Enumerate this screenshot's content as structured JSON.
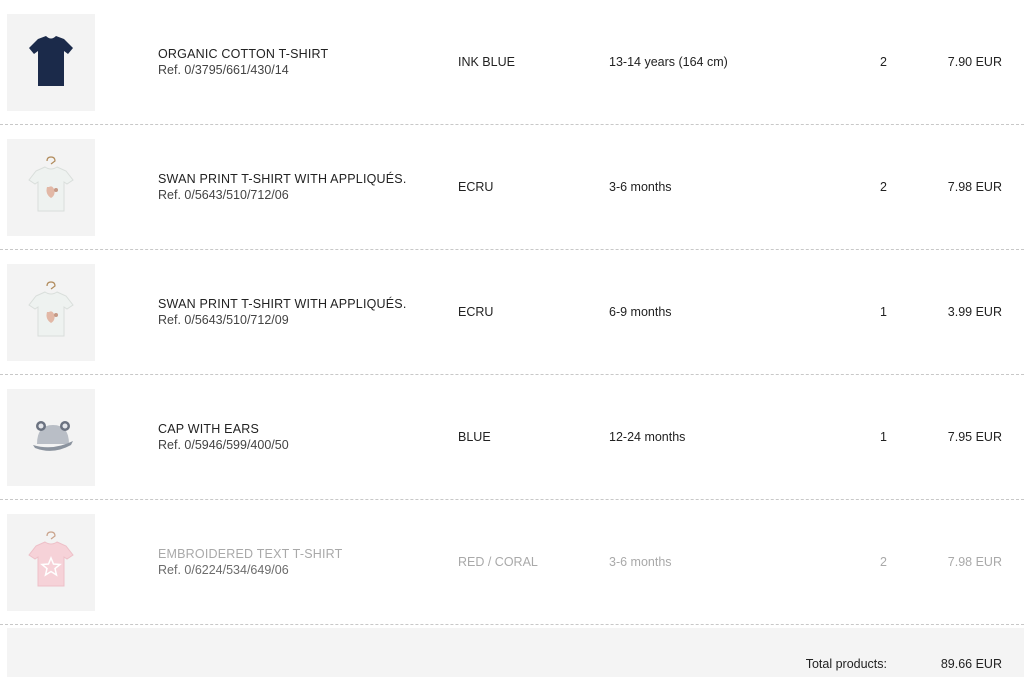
{
  "items": [
    {
      "name": "ORGANIC COTTON T-SHIRT",
      "ref": "Ref. 0/3795/661/430/14",
      "color": "INK BLUE",
      "size": "13-14 years (164 cm)",
      "qty": "2",
      "price": "7.90 EUR",
      "image": "navy-tshirt-icon",
      "faded": false
    },
    {
      "name": "SWAN PRINT T-SHIRT WITH APPLIQUÉS.",
      "ref": "Ref. 0/5643/510/712/06",
      "color": "ECRU",
      "size": "3-6 months",
      "qty": "2",
      "price": "7.98 EUR",
      "image": "swan-tshirt-icon",
      "faded": false
    },
    {
      "name": "SWAN PRINT T-SHIRT WITH APPLIQUÉS.",
      "ref": "Ref. 0/5643/510/712/09",
      "color": "ECRU",
      "size": "6-9 months",
      "qty": "1",
      "price": "3.99 EUR",
      "image": "swan-tshirt-icon",
      "faded": false
    },
    {
      "name": "CAP WITH EARS",
      "ref": "Ref. 0/5946/599/400/50",
      "color": "BLUE",
      "size": "12-24 months",
      "qty": "1",
      "price": "7.95 EUR",
      "image": "cap-icon",
      "faded": false
    },
    {
      "name": "EMBROIDERED TEXT T-SHIRT",
      "ref": "Ref. 0/6224/534/649/06",
      "color": "RED / CORAL",
      "size": "3-6 months",
      "qty": "2",
      "price": "7.98 EUR",
      "image": "pink-star-tshirt-icon",
      "faded": true
    }
  ],
  "summary": {
    "total_label": "Total products:",
    "total_value": "89.66 EUR"
  }
}
